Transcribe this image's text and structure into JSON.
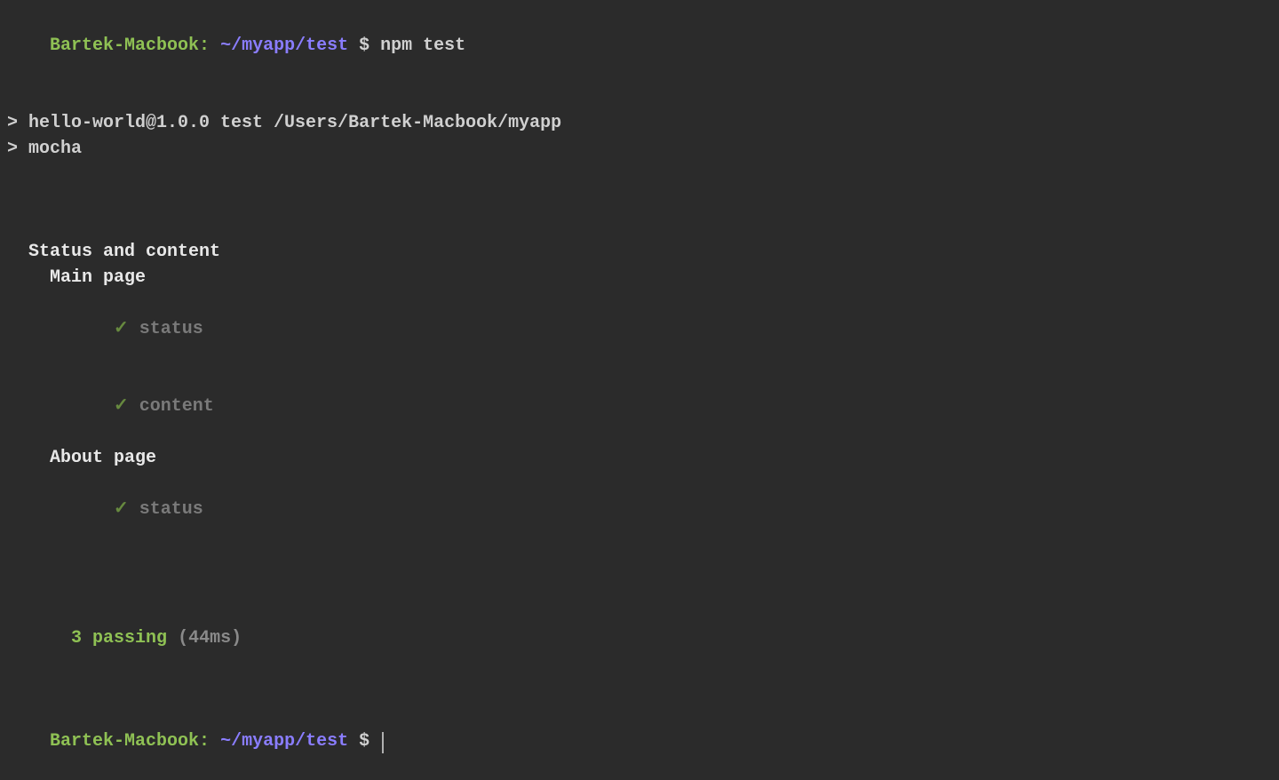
{
  "prompt1": {
    "host": "Bartek-Macbook:",
    "path": "~/myapp/test",
    "symbol": "$",
    "command": "npm test"
  },
  "npm_header": {
    "line1": "> hello-world@1.0.0 test /Users/Bartek-Macbook/myapp",
    "line2": "> mocha"
  },
  "suites": {
    "root": "Status and content",
    "group1": "Main page",
    "group1_tests": [
      {
        "check": "✓",
        "name": "status"
      },
      {
        "check": "✓",
        "name": "content"
      }
    ],
    "group2": "About page",
    "group2_tests": [
      {
        "check": "✓",
        "name": "status"
      }
    ]
  },
  "summary": {
    "passing": "3 passing",
    "time": "(44ms)"
  },
  "prompt2": {
    "host": "Bartek-Macbook:",
    "path": "~/myapp/test",
    "symbol": "$"
  }
}
